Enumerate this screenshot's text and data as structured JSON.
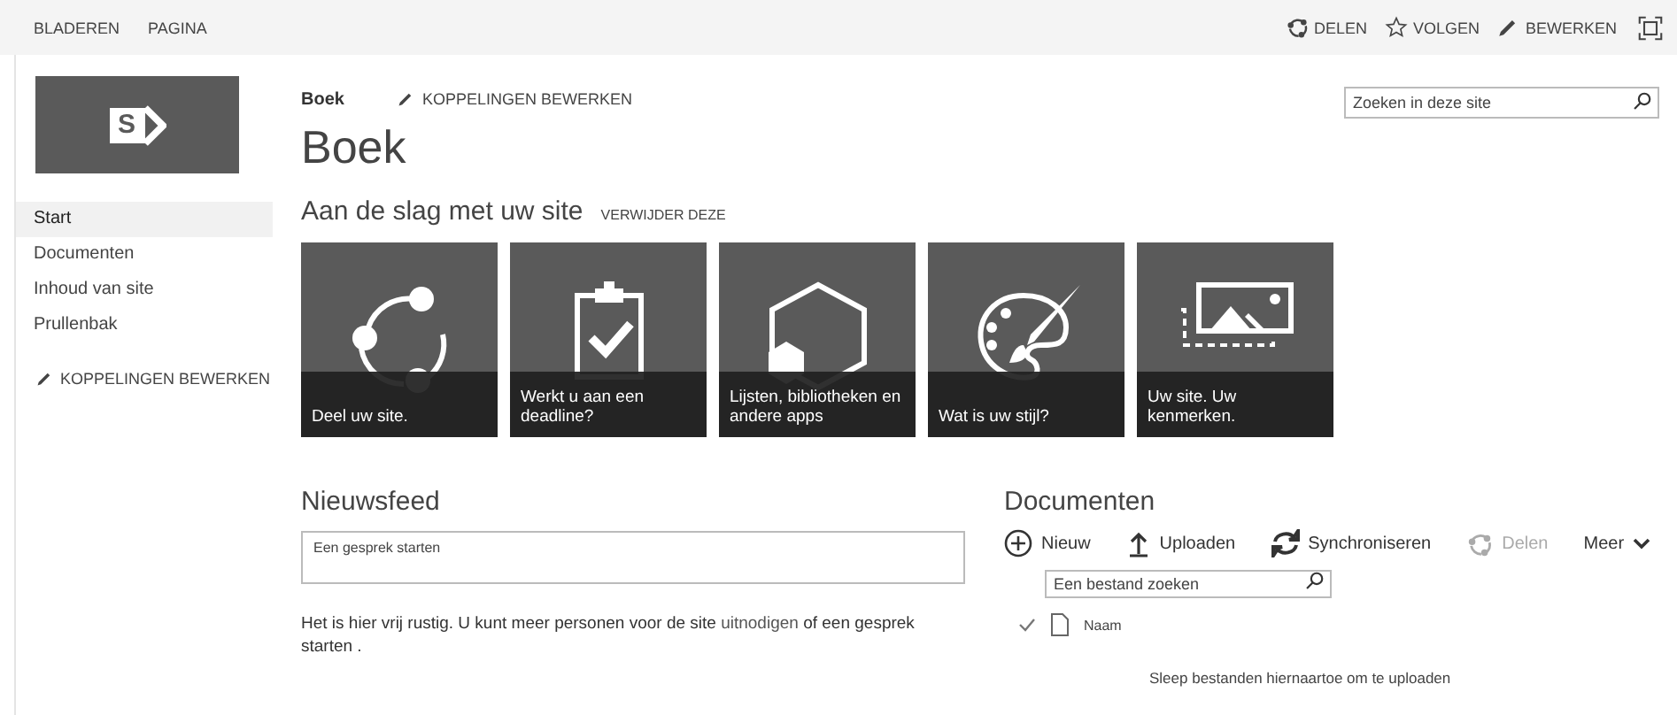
{
  "top_bar": {
    "tabs": [
      {
        "label": "BLADEREN",
        "selected": false
      },
      {
        "label": "PAGINA",
        "selected": false
      }
    ],
    "actions": [
      {
        "kind": "share",
        "label": "DELEN"
      },
      {
        "kind": "follow",
        "label": "VOLGEN"
      },
      {
        "kind": "edit",
        "label": "BEWERKEN"
      },
      {
        "kind": "focus"
      }
    ]
  },
  "logo": {
    "letter": "S"
  },
  "sidebar": {
    "items": [
      {
        "label": "Start",
        "selected": true
      },
      {
        "label": "Documenten",
        "selected": false
      },
      {
        "label": "Inhoud van site",
        "selected": false
      },
      {
        "label": "Prullenbak",
        "selected": false
      }
    ],
    "edit_links": "KOPPELINGEN BEWERKEN"
  },
  "header": {
    "breadcrumb": "Boek",
    "edit_links": "KOPPELINGEN BEWERKEN",
    "title": "Boek",
    "search": {
      "placeholder": "Zoeken in deze site"
    }
  },
  "getting_started": {
    "title": "Aan de slag met uw site",
    "dismiss": "VERWIJDER DEZE",
    "tiles": [
      {
        "kind": "share",
        "label": "Deel uw site."
      },
      {
        "kind": "task",
        "label": "Werkt u aan een deadline?"
      },
      {
        "kind": "apps",
        "label": "Lijsten, bibliotheken en andere apps"
      },
      {
        "kind": "style",
        "label": "Wat is uw stijl?"
      },
      {
        "kind": "brand",
        "label": "Uw site. Uw kenmerken."
      }
    ]
  },
  "newsfeed": {
    "title": "Nieuwsfeed",
    "input": {
      "placeholder": "Een gesprek starten"
    },
    "message": [
      {
        "kind": "text",
        "text": "Het is hier vrij rustig. U kunt meer personen voor de site "
      },
      {
        "kind": "link",
        "text": "uitnodigen"
      },
      {
        "kind": "text",
        "text": " of een gesprek starten ."
      }
    ]
  },
  "documents": {
    "title": "Documenten",
    "toolbar": [
      {
        "kind": "new",
        "label": "Nieuw",
        "disabled": false
      },
      {
        "kind": "upload",
        "label": "Uploaden",
        "disabled": false
      },
      {
        "kind": "sync",
        "label": "Synchroniseren",
        "disabled": false
      },
      {
        "kind": "share",
        "label": "Delen",
        "disabled": true
      },
      {
        "kind": "more",
        "label": "Meer",
        "disabled": false
      }
    ],
    "search": {
      "placeholder": "Een bestand zoeken"
    },
    "columns": [
      "Naam"
    ],
    "drop_hint": "Sleep bestanden hiernaartoe om te uploaden"
  }
}
